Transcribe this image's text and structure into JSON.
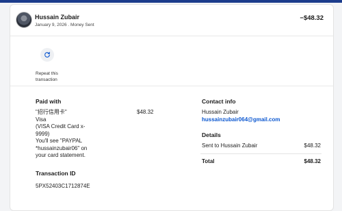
{
  "header": {
    "name": "Hussain Zubair",
    "subtitle": "January 9, 2026 . Money Sent",
    "amount": "−$48.32"
  },
  "actions": {
    "repeat_label": "Repeat this transaction",
    "icon": "refresh-icon"
  },
  "paid_with": {
    "heading": "Paid with",
    "method_line1": "\"招行信用卡\"",
    "method_line2": "Visa",
    "method_line3": "(VISA Credit Card x-",
    "method_line4": "9999)",
    "statement_line1": "You'll see \"PAYPAL",
    "statement_line2": "*hussainzubair06\" on",
    "statement_line3": "your card statement.",
    "amount": "$48.32"
  },
  "transaction": {
    "heading": "Transaction ID",
    "id": "5PX52403C1712874E"
  },
  "contact": {
    "heading": "Contact info",
    "name": "Hussain Zubair",
    "email": "hussainzubair064@gmail.com"
  },
  "details": {
    "heading": "Details",
    "sent_label": "Sent to Hussain Zubair",
    "sent_amount": "$48.32",
    "total_label": "Total",
    "total_amount": "$48.32"
  },
  "colors": {
    "accent_link": "#0b57d0",
    "top_bar": "#1c3c8c"
  }
}
